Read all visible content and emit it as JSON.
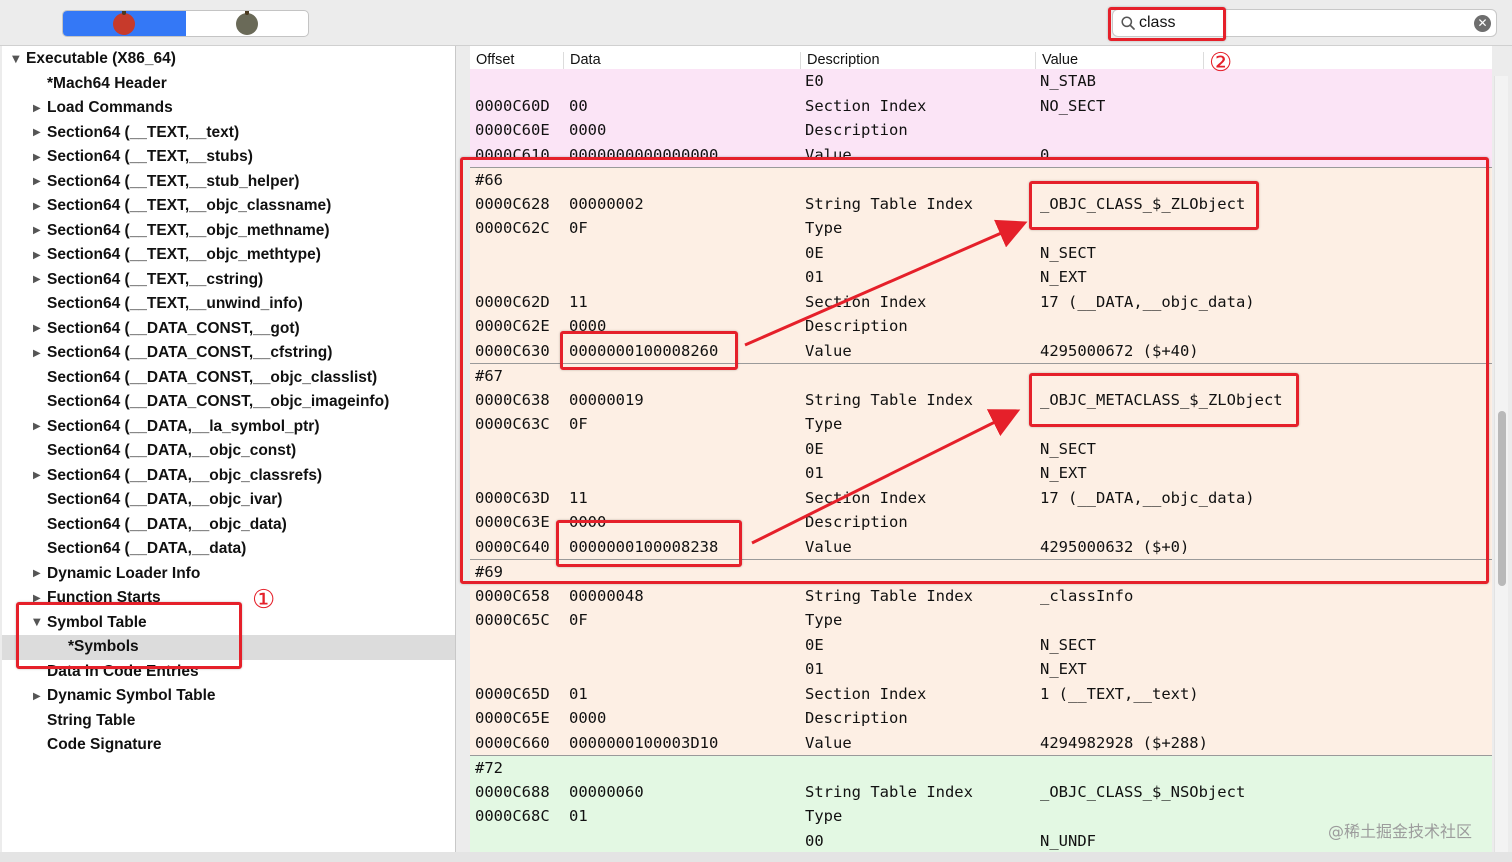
{
  "search": {
    "value": "class",
    "clear_glyph": "✕"
  },
  "toolbar": {
    "segments": [
      {
        "icon": "app-icon-active"
      },
      {
        "icon": "app-icon-inactive"
      }
    ]
  },
  "sidebar": {
    "items": [
      {
        "label": "Executable  (X86_64)",
        "indent": 0,
        "disclosure": "open"
      },
      {
        "label": "*Mach64 Header",
        "indent": 1,
        "disclosure": "none"
      },
      {
        "label": "Load Commands",
        "indent": 1,
        "disclosure": "closed"
      },
      {
        "label": "Section64 (__TEXT,__text)",
        "indent": 1,
        "disclosure": "closed"
      },
      {
        "label": "Section64 (__TEXT,__stubs)",
        "indent": 1,
        "disclosure": "closed"
      },
      {
        "label": "Section64 (__TEXT,__stub_helper)",
        "indent": 1,
        "disclosure": "closed"
      },
      {
        "label": "Section64 (__TEXT,__objc_classname)",
        "indent": 1,
        "disclosure": "closed"
      },
      {
        "label": "Section64 (__TEXT,__objc_methname)",
        "indent": 1,
        "disclosure": "closed"
      },
      {
        "label": "Section64 (__TEXT,__objc_methtype)",
        "indent": 1,
        "disclosure": "closed"
      },
      {
        "label": "Section64 (__TEXT,__cstring)",
        "indent": 1,
        "disclosure": "closed"
      },
      {
        "label": "Section64 (__TEXT,__unwind_info)",
        "indent": 1,
        "disclosure": "none"
      },
      {
        "label": "Section64 (__DATA_CONST,__got)",
        "indent": 1,
        "disclosure": "closed"
      },
      {
        "label": "Section64 (__DATA_CONST,__cfstring)",
        "indent": 1,
        "disclosure": "closed"
      },
      {
        "label": "Section64 (__DATA_CONST,__objc_classlist)",
        "indent": 1,
        "disclosure": "none"
      },
      {
        "label": "Section64 (__DATA_CONST,__objc_imageinfo)",
        "indent": 1,
        "disclosure": "none"
      },
      {
        "label": "Section64 (__DATA,__la_symbol_ptr)",
        "indent": 1,
        "disclosure": "closed"
      },
      {
        "label": "Section64 (__DATA,__objc_const)",
        "indent": 1,
        "disclosure": "none"
      },
      {
        "label": "Section64 (__DATA,__objc_classrefs)",
        "indent": 1,
        "disclosure": "closed"
      },
      {
        "label": "Section64 (__DATA,__objc_ivar)",
        "indent": 1,
        "disclosure": "none"
      },
      {
        "label": "Section64 (__DATA,__objc_data)",
        "indent": 1,
        "disclosure": "none"
      },
      {
        "label": "Section64 (__DATA,__data)",
        "indent": 1,
        "disclosure": "none"
      },
      {
        "label": "Dynamic Loader Info",
        "indent": 1,
        "disclosure": "closed"
      },
      {
        "label": "Function Starts",
        "indent": 1,
        "disclosure": "closed"
      },
      {
        "label": "Symbol Table",
        "indent": 1,
        "disclosure": "open"
      },
      {
        "label": "*Symbols",
        "indent": 2,
        "disclosure": "none",
        "selected": true
      },
      {
        "label": "Data in Code Entries",
        "indent": 1,
        "disclosure": "none"
      },
      {
        "label": "Dynamic Symbol Table",
        "indent": 1,
        "disclosure": "closed"
      },
      {
        "label": "String Table",
        "indent": 1,
        "disclosure": "none"
      },
      {
        "label": "Code Signature",
        "indent": 1,
        "disclosure": "none"
      }
    ]
  },
  "table": {
    "columns": [
      "Offset",
      "Data",
      "Description",
      "Value"
    ],
    "rows": [
      {
        "offset": "",
        "data": "",
        "desc": "E0",
        "value": "N_STAB",
        "bg": "pink"
      },
      {
        "offset": "0000C60D",
        "data": "00",
        "desc": "Section Index",
        "value": "NO_SECT",
        "bg": "pink"
      },
      {
        "offset": "0000C60E",
        "data": "0000",
        "desc": "Description",
        "value": "",
        "bg": "pink"
      },
      {
        "offset": "0000C610",
        "data": "0000000000000000",
        "desc": "Value",
        "value": "0",
        "bg": "pink"
      },
      {
        "offset": "#66",
        "data": "",
        "desc": "",
        "value": "",
        "bg": "peach",
        "sep": true
      },
      {
        "offset": "0000C628",
        "data": "00000002",
        "desc": "String Table Index",
        "value": "_OBJC_CLASS_$_ZLObject",
        "bg": "peach"
      },
      {
        "offset": "0000C62C",
        "data": "0F",
        "desc": "Type",
        "value": "",
        "bg": "peach"
      },
      {
        "offset": "",
        "data": "",
        "desc": "0E",
        "value": "N_SECT",
        "bg": "peach"
      },
      {
        "offset": "",
        "data": "",
        "desc": "01",
        "value": "N_EXT",
        "bg": "peach"
      },
      {
        "offset": "0000C62D",
        "data": "11",
        "desc": "Section Index",
        "value": "17 (__DATA,__objc_data)",
        "bg": "peach"
      },
      {
        "offset": "0000C62E",
        "data": "0000",
        "desc": "Description",
        "value": "",
        "bg": "peach"
      },
      {
        "offset": "0000C630",
        "data": "0000000100008260",
        "desc": "Value",
        "value": "4295000672 ($+40)",
        "bg": "peach"
      },
      {
        "offset": "#67",
        "data": "",
        "desc": "",
        "value": "",
        "bg": "peach",
        "sep": true
      },
      {
        "offset": "0000C638",
        "data": "00000019",
        "desc": "String Table Index",
        "value": "_OBJC_METACLASS_$_ZLObject",
        "bg": "peach"
      },
      {
        "offset": "0000C63C",
        "data": "0F",
        "desc": "Type",
        "value": "",
        "bg": "peach"
      },
      {
        "offset": "",
        "data": "",
        "desc": "0E",
        "value": "N_SECT",
        "bg": "peach"
      },
      {
        "offset": "",
        "data": "",
        "desc": "01",
        "value": "N_EXT",
        "bg": "peach"
      },
      {
        "offset": "0000C63D",
        "data": "11",
        "desc": "Section Index",
        "value": "17 (__DATA,__objc_data)",
        "bg": "peach"
      },
      {
        "offset": "0000C63E",
        "data": "0000",
        "desc": "Description",
        "value": "",
        "bg": "peach"
      },
      {
        "offset": "0000C640",
        "data": "0000000100008238",
        "desc": "Value",
        "value": "4295000632 ($+0)",
        "bg": "peach"
      },
      {
        "offset": "#69",
        "data": "",
        "desc": "",
        "value": "",
        "bg": "peach",
        "sep": true
      },
      {
        "offset": "0000C658",
        "data": "00000048",
        "desc": "String Table Index",
        "value": "_classInfo",
        "bg": "peach"
      },
      {
        "offset": "0000C65C",
        "data": "0F",
        "desc": "Type",
        "value": "",
        "bg": "peach"
      },
      {
        "offset": "",
        "data": "",
        "desc": "0E",
        "value": "N_SECT",
        "bg": "peach"
      },
      {
        "offset": "",
        "data": "",
        "desc": "01",
        "value": "N_EXT",
        "bg": "peach"
      },
      {
        "offset": "0000C65D",
        "data": "01",
        "desc": "Section Index",
        "value": "1 (__TEXT,__text)",
        "bg": "peach"
      },
      {
        "offset": "0000C65E",
        "data": "0000",
        "desc": "Description",
        "value": "",
        "bg": "peach"
      },
      {
        "offset": "0000C660",
        "data": "0000000100003D10",
        "desc": "Value",
        "value": "4294982928 ($+288)",
        "bg": "peach"
      },
      {
        "offset": "#72",
        "data": "",
        "desc": "",
        "value": "",
        "bg": "green",
        "sep": true
      },
      {
        "offset": "0000C688",
        "data": "00000060",
        "desc": "String Table Index",
        "value": "_OBJC_CLASS_$_NSObject",
        "bg": "green"
      },
      {
        "offset": "0000C68C",
        "data": "01",
        "desc": "Type",
        "value": "",
        "bg": "green"
      },
      {
        "offset": "",
        "data": "",
        "desc": "00",
        "value": "N_UNDF",
        "bg": "green"
      }
    ]
  },
  "annotations": {
    "marker_1": "①",
    "marker_2": "②",
    "color": "#e5202a"
  },
  "watermark": "@稀土掘金技术社区"
}
